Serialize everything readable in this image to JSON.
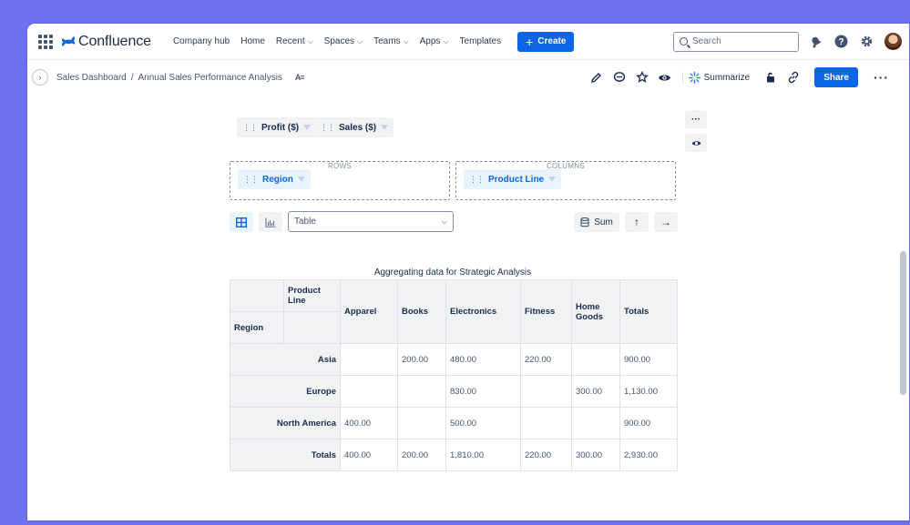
{
  "nav": {
    "logo": "Confluence",
    "links": [
      {
        "label": "Company hub",
        "dropdown": false
      },
      {
        "label": "Home",
        "dropdown": false
      },
      {
        "label": "Recent",
        "dropdown": true
      },
      {
        "label": "Spaces",
        "dropdown": true
      },
      {
        "label": "Teams",
        "dropdown": true
      },
      {
        "label": "Apps",
        "dropdown": true
      },
      {
        "label": "Templates",
        "dropdown": false
      }
    ],
    "create_label": "Create",
    "search_placeholder": "Search"
  },
  "breadcrumb": {
    "items": [
      "Sales Dashboard",
      "Annual Sales Performance Analysis"
    ],
    "separator": "/"
  },
  "page_actions": {
    "summarize_label": "Summarize",
    "share_label": "Share"
  },
  "pivot": {
    "value_fields": [
      "Profit ($)",
      "Sales ($)"
    ],
    "rows_label": "ROWS",
    "columns_label": "COLUMNS",
    "row_field": "Region",
    "column_field": "Product Line",
    "renderer": "Table",
    "aggregator": "Sum",
    "title": "Aggregating data for Strategic Analysis",
    "header_col_label": "Product Line",
    "header_row_label": "Region",
    "columns": [
      "Apparel",
      "Books",
      "Electronics",
      "Fitness",
      "Home Goods",
      "Totals"
    ],
    "rows": [
      {
        "label": "Asia",
        "values": [
          "",
          "200.00",
          "480.00",
          "220.00",
          "",
          "900.00"
        ]
      },
      {
        "label": "Europe",
        "values": [
          "",
          "",
          "830.00",
          "",
          "300.00",
          "1,130.00"
        ]
      },
      {
        "label": "North America",
        "values": [
          "400.00",
          "",
          "500.00",
          "",
          "",
          "900.00"
        ]
      },
      {
        "label": "Totals",
        "values": [
          "400.00",
          "200.00",
          "1,810.00",
          "220.00",
          "300.00",
          "2,930.00"
        ]
      }
    ]
  },
  "colors": {
    "background": "#6b71f0",
    "primary": "#0c66e4",
    "chip_bg": "#f1f2f4",
    "chip_blue_bg": "#e9f2ff"
  }
}
